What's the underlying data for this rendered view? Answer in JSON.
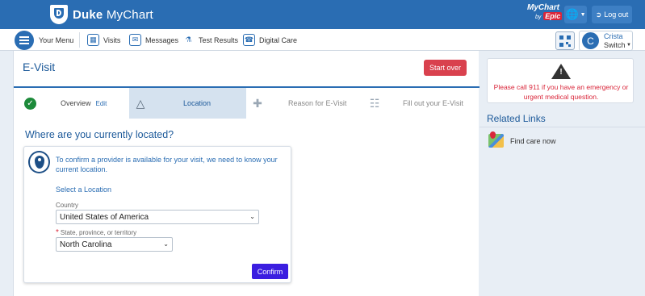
{
  "header": {
    "brand_bold": "Duke",
    "brand_rest": " MyChart",
    "mychart_logo": "MyChart",
    "by_text": "by",
    "epic_text": "Epic",
    "logout_label": "Log out"
  },
  "nav": {
    "your_menu": "Your Menu",
    "visits": "Visits",
    "messages": "Messages",
    "test_results": "Test Results",
    "digital_care": "Digital Care",
    "user_name": "Crista",
    "user_initial": "C",
    "user_switch": "Switch"
  },
  "main": {
    "title": "E-Visit",
    "start_over": "Start over",
    "steps": {
      "overview": "Overview",
      "overview_edit": "Edit",
      "location": "Location",
      "reason": "Reason for E-Visit",
      "fill_out": "Fill out your E-Visit"
    },
    "question": "Where are you currently located?",
    "card": {
      "message": "To confirm a provider is available for your visit, we need to know your current location.",
      "select_location": "Select a Location",
      "country_label": "Country",
      "country_value": "United States of America",
      "state_label": "State, province, or territory",
      "state_value": "North Carolina",
      "confirm": "Confirm"
    }
  },
  "right": {
    "alert": "Please call 911 if you have an emergency or urgent medical question.",
    "related_title": "Related Links",
    "find_care": "Find care now"
  },
  "colors": {
    "header_blue": "#2a6db3",
    "start_over_red": "#d9414e",
    "confirm_purple": "#3b1ee0",
    "alert_red": "#d9263a",
    "check_green": "#1d8a3a"
  }
}
